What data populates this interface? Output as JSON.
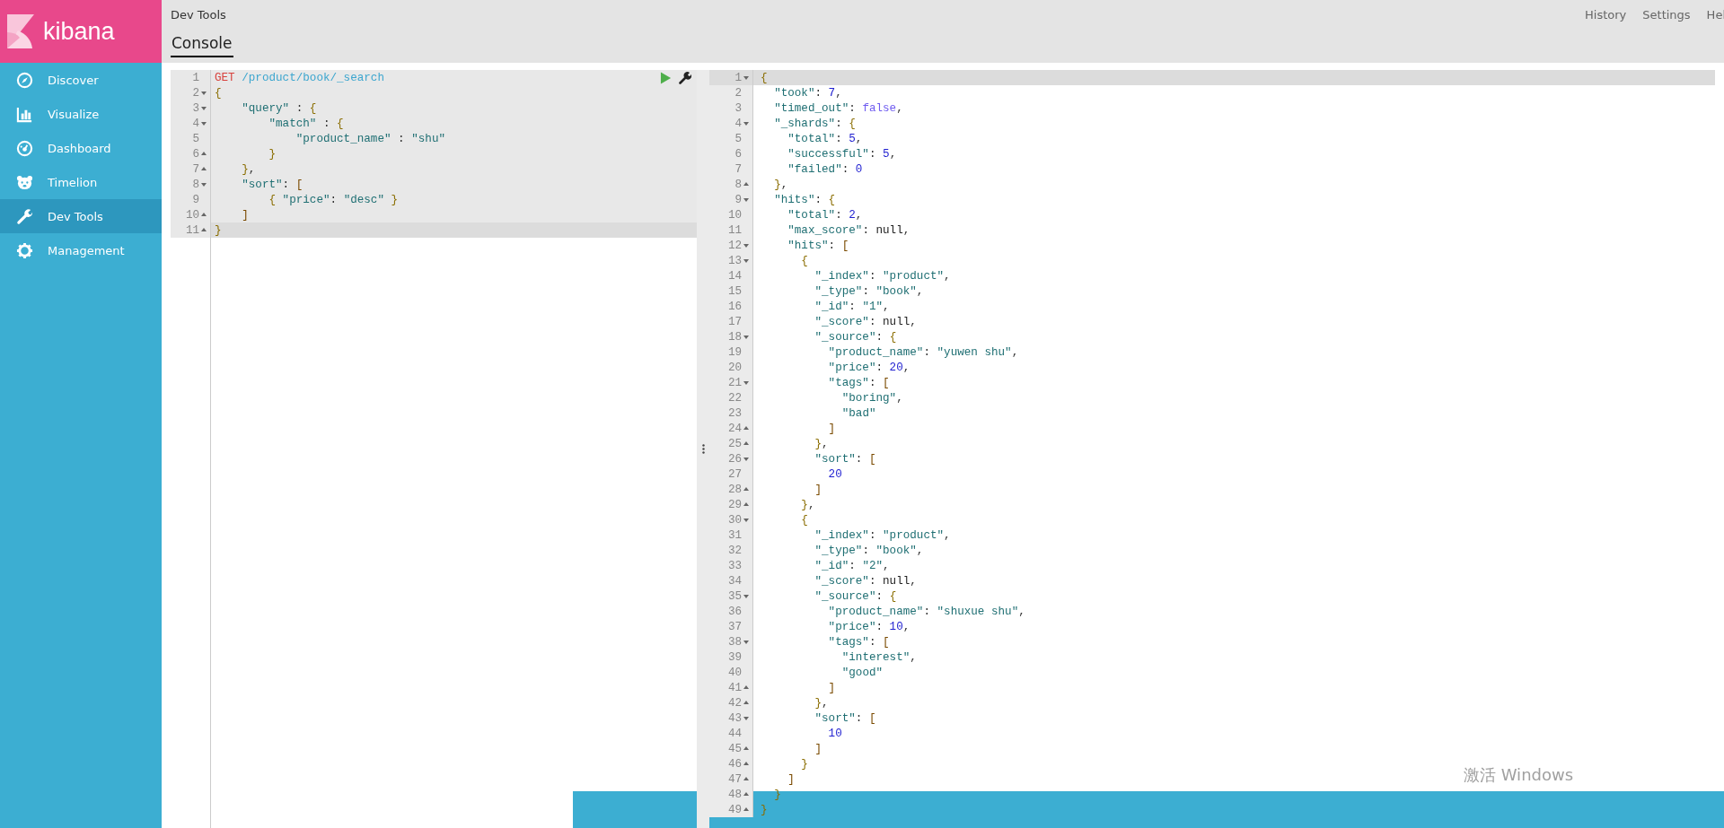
{
  "sidebar": {
    "logo": "kibana",
    "items": [
      {
        "label": "Discover",
        "kind": "compass",
        "selected": false
      },
      {
        "label": "Visualize",
        "kind": "chart",
        "selected": false
      },
      {
        "label": "Dashboard",
        "kind": "dashboard",
        "selected": false
      },
      {
        "label": "Timelion",
        "kind": "bear",
        "selected": false
      },
      {
        "label": "Dev Tools",
        "kind": "wrench",
        "selected": true
      },
      {
        "label": "Management",
        "kind": "gear",
        "selected": false
      }
    ]
  },
  "header": {
    "title": "Dev Tools",
    "links": [
      "History",
      "Settings",
      "Hel"
    ],
    "tabs": [
      {
        "label": "Console",
        "selected": true
      }
    ]
  },
  "request_editor": {
    "method": "GET",
    "path": "/product/book/_search",
    "lines": [
      {
        "num": "1",
        "fold_start": false,
        "fold_end": false,
        "highlighted": false,
        "kind": "request"
      },
      {
        "num": "2",
        "fold_start": true,
        "fold_end": false,
        "highlighted": false,
        "text": "{"
      },
      {
        "num": "3",
        "fold_start": true,
        "fold_end": false,
        "highlighted": false,
        "text": "    \"query\" : {"
      },
      {
        "num": "4",
        "fold_start": true,
        "fold_end": false,
        "highlighted": false,
        "text": "        \"match\" : {"
      },
      {
        "num": "5",
        "fold_start": false,
        "fold_end": false,
        "highlighted": false,
        "text": "            \"product_name\" : \"shu\""
      },
      {
        "num": "6",
        "fold_start": false,
        "fold_end": true,
        "highlighted": false,
        "text": "        }"
      },
      {
        "num": "7",
        "fold_start": false,
        "fold_end": true,
        "highlighted": false,
        "text": "    },"
      },
      {
        "num": "8",
        "fold_start": true,
        "fold_end": false,
        "highlighted": false,
        "text": "    \"sort\": ["
      },
      {
        "num": "9",
        "fold_start": false,
        "fold_end": false,
        "highlighted": false,
        "text": "        { \"price\": \"desc\" }"
      },
      {
        "num": "10",
        "fold_start": false,
        "fold_end": true,
        "highlighted": false,
        "text": "    ]"
      },
      {
        "num": "11",
        "fold_start": false,
        "fold_end": true,
        "highlighted": true,
        "text": "}"
      }
    ]
  },
  "response_editor": {
    "lines": [
      {
        "num": "1",
        "fold_start": true,
        "fold_end": false,
        "highlighted": true,
        "text": "{"
      },
      {
        "num": "2",
        "fold_start": false,
        "fold_end": false,
        "highlighted": false,
        "text": "  \"took\": 7,"
      },
      {
        "num": "3",
        "fold_start": false,
        "fold_end": false,
        "highlighted": false,
        "text": "  \"timed_out\": false,"
      },
      {
        "num": "4",
        "fold_start": true,
        "fold_end": false,
        "highlighted": false,
        "text": "  \"_shards\": {"
      },
      {
        "num": "5",
        "fold_start": false,
        "fold_end": false,
        "highlighted": false,
        "text": "    \"total\": 5,"
      },
      {
        "num": "6",
        "fold_start": false,
        "fold_end": false,
        "highlighted": false,
        "text": "    \"successful\": 5,"
      },
      {
        "num": "7",
        "fold_start": false,
        "fold_end": false,
        "highlighted": false,
        "text": "    \"failed\": 0"
      },
      {
        "num": "8",
        "fold_start": false,
        "fold_end": true,
        "highlighted": false,
        "text": "  },"
      },
      {
        "num": "9",
        "fold_start": true,
        "fold_end": false,
        "highlighted": false,
        "text": "  \"hits\": {"
      },
      {
        "num": "10",
        "fold_start": false,
        "fold_end": false,
        "highlighted": false,
        "text": "    \"total\": 2,"
      },
      {
        "num": "11",
        "fold_start": false,
        "fold_end": false,
        "highlighted": false,
        "text": "    \"max_score\": null,"
      },
      {
        "num": "12",
        "fold_start": true,
        "fold_end": false,
        "highlighted": false,
        "text": "    \"hits\": ["
      },
      {
        "num": "13",
        "fold_start": true,
        "fold_end": false,
        "highlighted": false,
        "text": "      {"
      },
      {
        "num": "14",
        "fold_start": false,
        "fold_end": false,
        "highlighted": false,
        "text": "        \"_index\": \"product\","
      },
      {
        "num": "15",
        "fold_start": false,
        "fold_end": false,
        "highlighted": false,
        "text": "        \"_type\": \"book\","
      },
      {
        "num": "16",
        "fold_start": false,
        "fold_end": false,
        "highlighted": false,
        "text": "        \"_id\": \"1\","
      },
      {
        "num": "17",
        "fold_start": false,
        "fold_end": false,
        "highlighted": false,
        "text": "        \"_score\": null,"
      },
      {
        "num": "18",
        "fold_start": true,
        "fold_end": false,
        "highlighted": false,
        "text": "        \"_source\": {"
      },
      {
        "num": "19",
        "fold_start": false,
        "fold_end": false,
        "highlighted": false,
        "text": "          \"product_name\": \"yuwen shu\","
      },
      {
        "num": "20",
        "fold_start": false,
        "fold_end": false,
        "highlighted": false,
        "text": "          \"price\": 20,"
      },
      {
        "num": "21",
        "fold_start": true,
        "fold_end": false,
        "highlighted": false,
        "text": "          \"tags\": ["
      },
      {
        "num": "22",
        "fold_start": false,
        "fold_end": false,
        "highlighted": false,
        "text": "            \"boring\","
      },
      {
        "num": "23",
        "fold_start": false,
        "fold_end": false,
        "highlighted": false,
        "text": "            \"bad\""
      },
      {
        "num": "24",
        "fold_start": false,
        "fold_end": true,
        "highlighted": false,
        "text": "          ]"
      },
      {
        "num": "25",
        "fold_start": false,
        "fold_end": true,
        "highlighted": false,
        "text": "        },"
      },
      {
        "num": "26",
        "fold_start": true,
        "fold_end": false,
        "highlighted": false,
        "text": "        \"sort\": ["
      },
      {
        "num": "27",
        "fold_start": false,
        "fold_end": false,
        "highlighted": false,
        "text": "          20"
      },
      {
        "num": "28",
        "fold_start": false,
        "fold_end": true,
        "highlighted": false,
        "text": "        ]"
      },
      {
        "num": "29",
        "fold_start": false,
        "fold_end": true,
        "highlighted": false,
        "text": "      },"
      },
      {
        "num": "30",
        "fold_start": true,
        "fold_end": false,
        "highlighted": false,
        "text": "      {"
      },
      {
        "num": "31",
        "fold_start": false,
        "fold_end": false,
        "highlighted": false,
        "text": "        \"_index\": \"product\","
      },
      {
        "num": "32",
        "fold_start": false,
        "fold_end": false,
        "highlighted": false,
        "text": "        \"_type\": \"book\","
      },
      {
        "num": "33",
        "fold_start": false,
        "fold_end": false,
        "highlighted": false,
        "text": "        \"_id\": \"2\","
      },
      {
        "num": "34",
        "fold_start": false,
        "fold_end": false,
        "highlighted": false,
        "text": "        \"_score\": null,"
      },
      {
        "num": "35",
        "fold_start": true,
        "fold_end": false,
        "highlighted": false,
        "text": "        \"_source\": {"
      },
      {
        "num": "36",
        "fold_start": false,
        "fold_end": false,
        "highlighted": false,
        "text": "          \"product_name\": \"shuxue shu\","
      },
      {
        "num": "37",
        "fold_start": false,
        "fold_end": false,
        "highlighted": false,
        "text": "          \"price\": 10,"
      },
      {
        "num": "38",
        "fold_start": true,
        "fold_end": false,
        "highlighted": false,
        "text": "          \"tags\": ["
      },
      {
        "num": "39",
        "fold_start": false,
        "fold_end": false,
        "highlighted": false,
        "text": "            \"interest\","
      },
      {
        "num": "40",
        "fold_start": false,
        "fold_end": false,
        "highlighted": false,
        "text": "            \"good\""
      },
      {
        "num": "41",
        "fold_start": false,
        "fold_end": true,
        "highlighted": false,
        "text": "          ]"
      },
      {
        "num": "42",
        "fold_start": false,
        "fold_end": true,
        "highlighted": false,
        "text": "        },"
      },
      {
        "num": "43",
        "fold_start": true,
        "fold_end": false,
        "highlighted": false,
        "text": "        \"sort\": ["
      },
      {
        "num": "44",
        "fold_start": false,
        "fold_end": false,
        "highlighted": false,
        "text": "          10"
      },
      {
        "num": "45",
        "fold_start": false,
        "fold_end": true,
        "highlighted": false,
        "text": "        ]"
      },
      {
        "num": "46",
        "fold_start": false,
        "fold_end": true,
        "highlighted": false,
        "text": "      }"
      },
      {
        "num": "47",
        "fold_start": false,
        "fold_end": true,
        "highlighted": false,
        "text": "    ]"
      },
      {
        "num": "48",
        "fold_start": false,
        "fold_end": true,
        "highlighted": false,
        "text": "  }"
      },
      {
        "num": "49",
        "fold_start": false,
        "fold_end": true,
        "highlighted": false,
        "text": "}"
      }
    ]
  },
  "os_notice": "激活 Windows"
}
